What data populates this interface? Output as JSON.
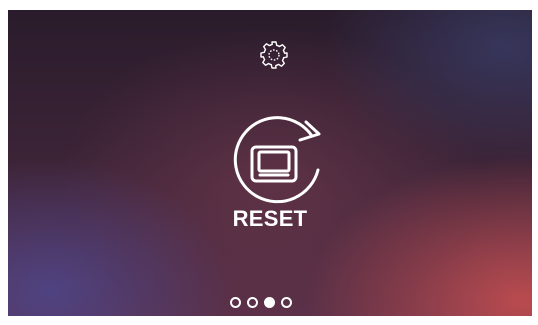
{
  "screen": {
    "title_icon": "gear-icon",
    "action": {
      "icon": "reset-device-icon",
      "label": "RESET"
    },
    "pager": {
      "pages": 4,
      "active_index": 2
    }
  },
  "colors": {
    "foreground": "#ffffff",
    "background_top": "#2a1c2c",
    "background_bottom_left": "#4e468c",
    "background_bottom_right": "#c44e50"
  }
}
